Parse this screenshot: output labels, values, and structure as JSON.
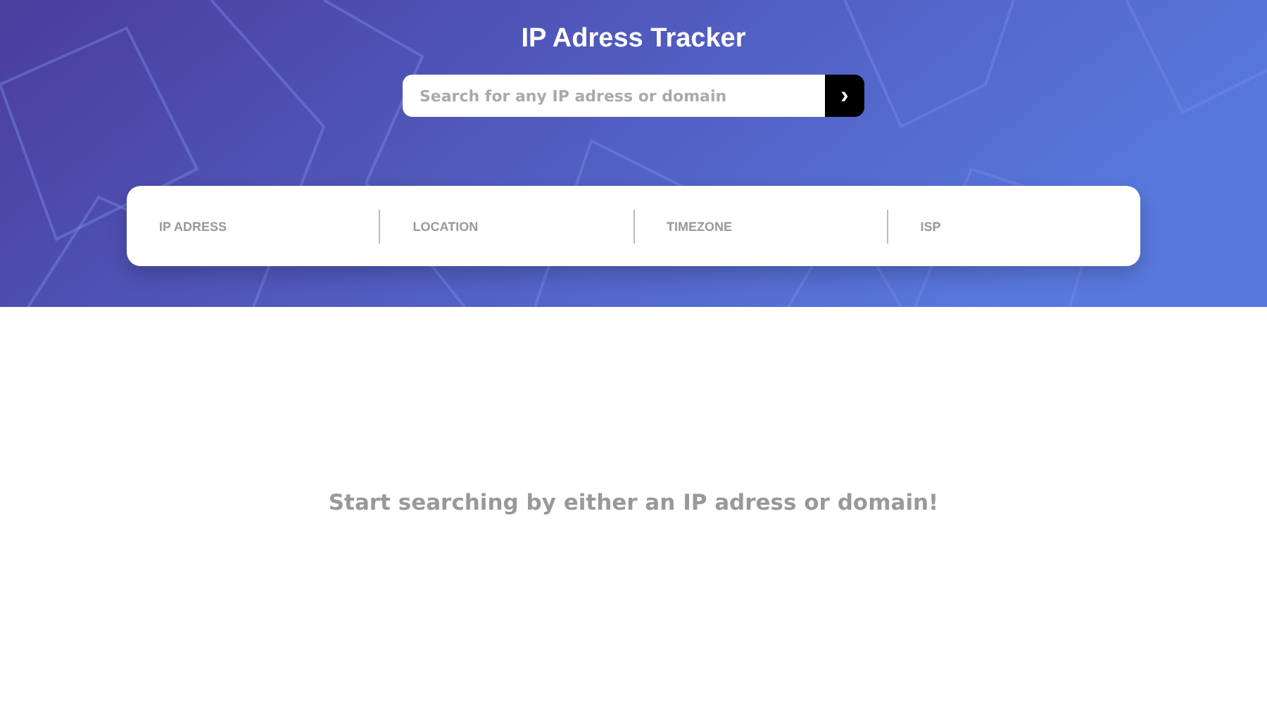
{
  "header": {
    "title": "IP Adress Tracker",
    "search": {
      "placeholder": "Search for any IP adress or domain",
      "button": "›"
    }
  },
  "info_card": {
    "fields": [
      {
        "label": "IP ADRESS"
      },
      {
        "label": "LOCATION"
      },
      {
        "label": "TIMEZONE"
      },
      {
        "label": "ISP"
      }
    ]
  },
  "message": "Start searching by either an IP adress or domain!"
}
